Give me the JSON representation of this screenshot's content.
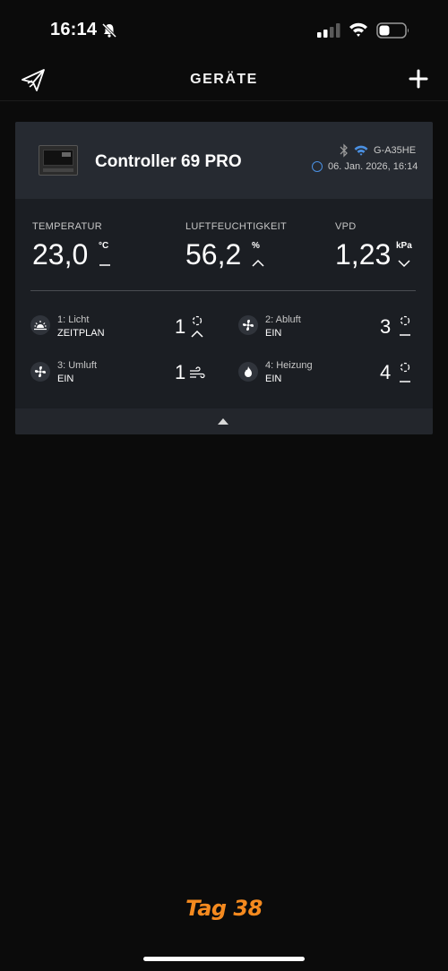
{
  "status_bar": {
    "time": "16:14",
    "icons": [
      "bell-slash-icon",
      "cellular-signal-icon",
      "wifi-icon",
      "battery-icon"
    ]
  },
  "nav": {
    "title": "GERÄTE",
    "logo_icon": "app-logo-icon",
    "add_icon": "plus-icon"
  },
  "device": {
    "name": "Controller 69 PRO",
    "id": "G-A35HE",
    "last_update": "06. Jan. 2026, 16:14",
    "connection_icons": [
      "bluetooth-icon",
      "wifi-icon",
      "sync-icon"
    ]
  },
  "metrics": {
    "temperature": {
      "label": "TEMPERATUR",
      "value": "23,0",
      "unit": "°C",
      "trend": "stable"
    },
    "humidity": {
      "label": "LUFTFEUCHTIGKEIT",
      "value": "56,2",
      "unit": "%",
      "trend": "up"
    },
    "vpd": {
      "label": "VPD",
      "value": "1,23",
      "unit": "kPa",
      "trend": "down"
    }
  },
  "ports": [
    {
      "name": "1: Licht",
      "mode": "ZEITPLAN",
      "level": "1",
      "icon": "light-icon",
      "status": "up"
    },
    {
      "name": "2: Abluft",
      "mode": "EIN",
      "level": "3",
      "icon": "fan-icon",
      "status": "stable"
    },
    {
      "name": "3: Umluft",
      "mode": "EIN",
      "level": "1",
      "icon": "fan-icon",
      "status": "wind"
    },
    {
      "name": "4: Heizung",
      "mode": "EIN",
      "level": "4",
      "icon": "flame-icon",
      "status": "stable"
    }
  ],
  "footer_label": "Tag 38",
  "colors": {
    "background": "#0b0b0b",
    "card": "#1b1e23",
    "card_header": "#262a31",
    "accent_blue": "#4a90e2",
    "tag_orange": "#f58a1f"
  }
}
